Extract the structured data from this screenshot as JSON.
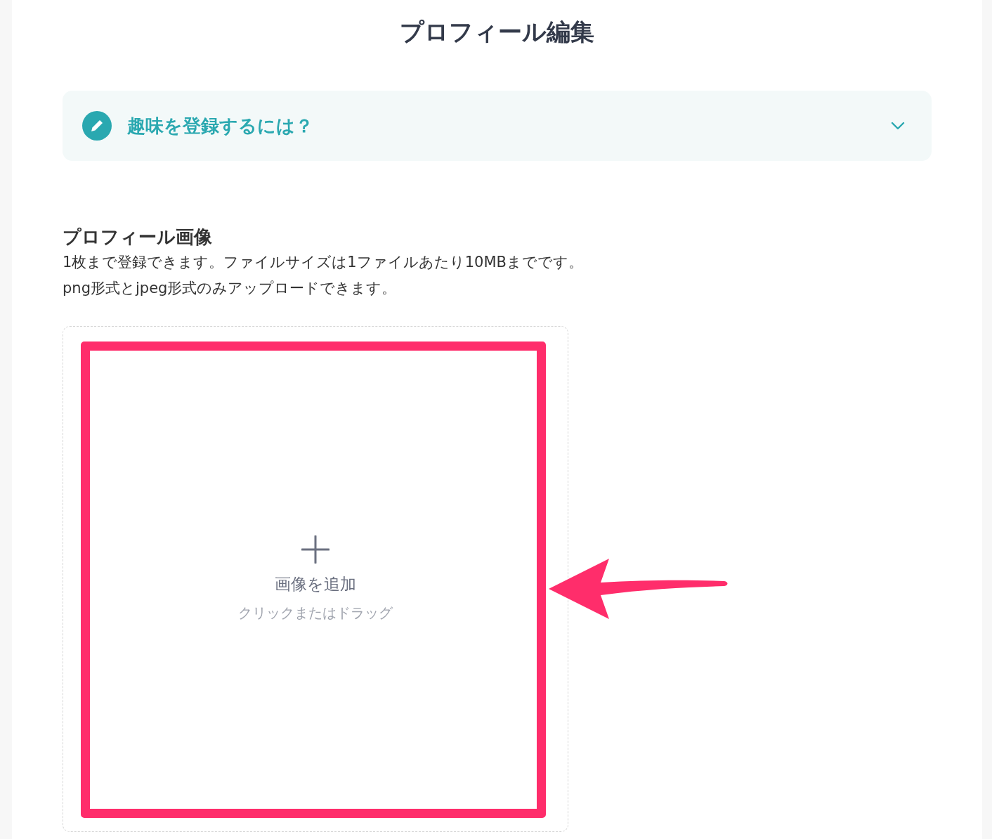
{
  "title": "プロフィール編集",
  "help": {
    "label": "趣味を登録するには？",
    "expanded": false
  },
  "section": {
    "heading": "プロフィール画像",
    "description": [
      "1枚まで登録できます。ファイルサイズは1ファイルあたり10MBまでです。",
      "png形式とjpeg形式のみアップロードできます。"
    ]
  },
  "upload": {
    "label": "画像を追加",
    "hint": "クリックまたはドラッグ"
  }
}
